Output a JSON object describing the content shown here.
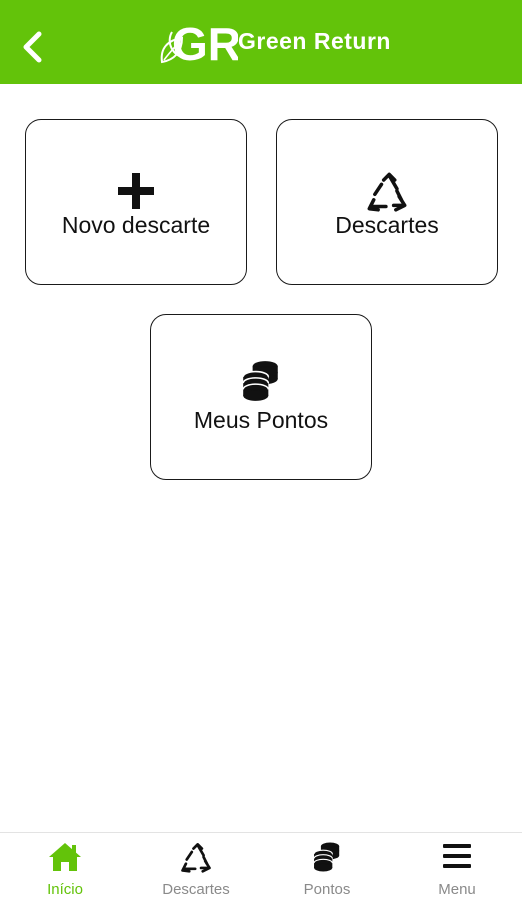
{
  "header": {
    "brand_name": "Green Return",
    "logo_letters": "GR",
    "color": "#63c30a"
  },
  "tiles": [
    {
      "label": "Novo descarte",
      "icon": "plus-icon"
    },
    {
      "label": "Descartes",
      "icon": "recycle-icon"
    },
    {
      "label": "Meus Pontos",
      "icon": "coins-icon"
    }
  ],
  "tabbar": {
    "active_color": "#63c30a",
    "inactive_color": "#8a8a8a",
    "tabs": [
      {
        "label": "Início",
        "icon": "home-icon",
        "active": true
      },
      {
        "label": "Descartes",
        "icon": "recycle-icon",
        "active": false
      },
      {
        "label": "Pontos",
        "icon": "coins-icon",
        "active": false
      },
      {
        "label": "Menu",
        "icon": "menu-icon",
        "active": false
      }
    ]
  }
}
